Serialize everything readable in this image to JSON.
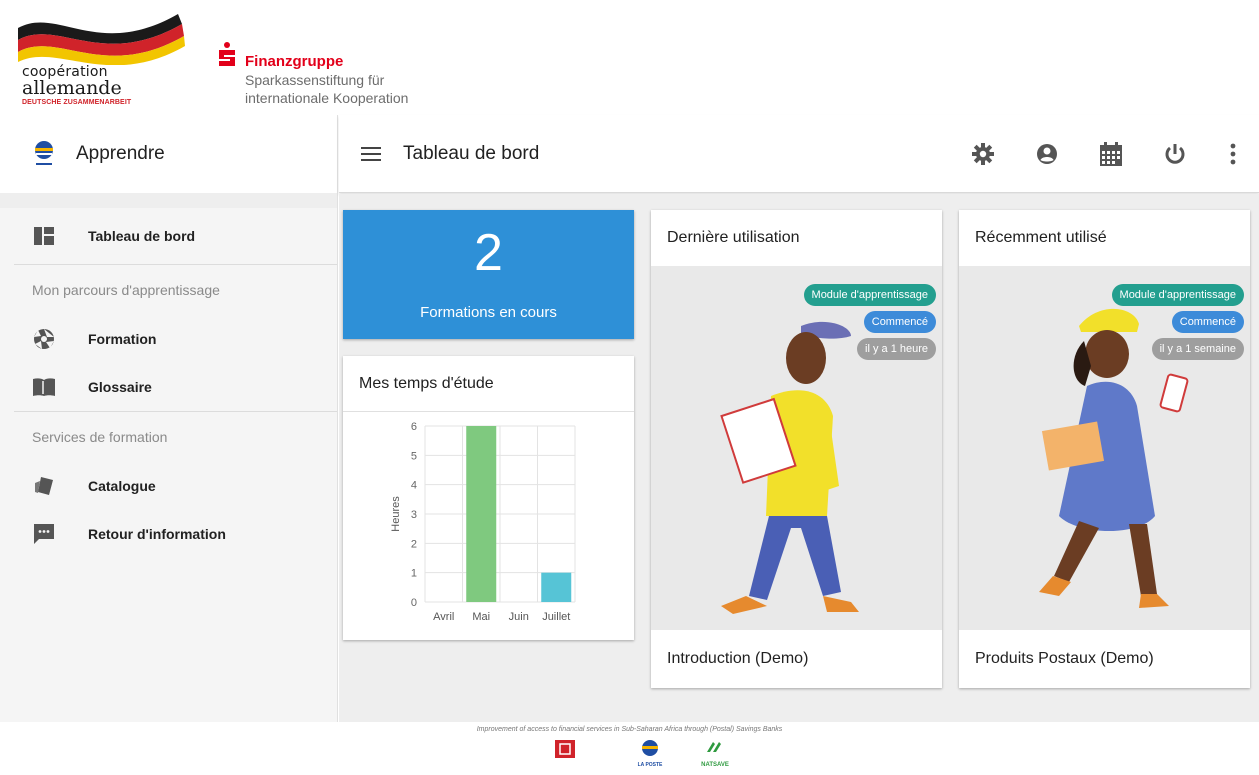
{
  "partners": {
    "coop_line1": "coopération",
    "coop_line2": "allemande",
    "coop_line3": "DEUTSCHE ZUSAMMENARBEIT",
    "spk_name": "Finanzgruppe",
    "spk_line1": "Sparkassenstiftung für",
    "spk_line2": "internationale Kooperation"
  },
  "sidebar": {
    "app_title": "Apprendre",
    "brand_icon": "la-poste-logo",
    "items": [
      {
        "label": "Tableau de bord",
        "icon": "dashboard-icon"
      }
    ],
    "section1_label": "Mon parcours d'apprentissage",
    "section1_items": [
      {
        "label": "Formation",
        "icon": "aperture-icon"
      },
      {
        "label": "Glossaire",
        "icon": "book-icon"
      }
    ],
    "section2_label": "Services de formation",
    "section2_items": [
      {
        "label": "Catalogue",
        "icon": "catalogue-icon"
      },
      {
        "label": "Retour d'information",
        "icon": "feedback-icon"
      }
    ]
  },
  "header": {
    "title": "Tableau de bord",
    "actions": [
      "settings-icon",
      "account-icon",
      "calendar-icon",
      "power-icon",
      "more-vert-icon"
    ]
  },
  "stat": {
    "value": "2",
    "label": "Formations en cours",
    "color": "#2e90d7"
  },
  "study": {
    "title": "Mes temps d'étude"
  },
  "chart_data": {
    "type": "bar",
    "categories": [
      "Avril",
      "Mai",
      "Juin",
      "Juillet"
    ],
    "values": [
      0,
      6,
      0,
      1
    ],
    "colors": [
      "#7fc97f",
      "#7fc97f",
      "#56c4d6",
      "#56c4d6"
    ],
    "ylabel": "Heures",
    "xlabel": "",
    "ylim": [
      0,
      6
    ],
    "yticks": [
      0,
      1,
      2,
      3,
      4,
      5,
      6
    ],
    "grid": true
  },
  "courses": [
    {
      "header": "Dernière utilisation",
      "chip_type": "Module d'apprentissage",
      "chip_status": "Commencé",
      "chip_time": "il y a 1 heure",
      "name": "Introduction (Demo)"
    },
    {
      "header": "Récemment utilisé",
      "chip_type": "Module d'apprentissage",
      "chip_status": "Commencé",
      "chip_time": "il y a 1 semaine",
      "name": "Produits Postaux (Demo)"
    }
  ],
  "footer": {
    "text": "Improvement of access to financial services in Sub-Saharan Africa through (Postal) Savings Banks",
    "logo_laposte": "LA POSTE",
    "logo_natsave": "NATSAVE"
  }
}
